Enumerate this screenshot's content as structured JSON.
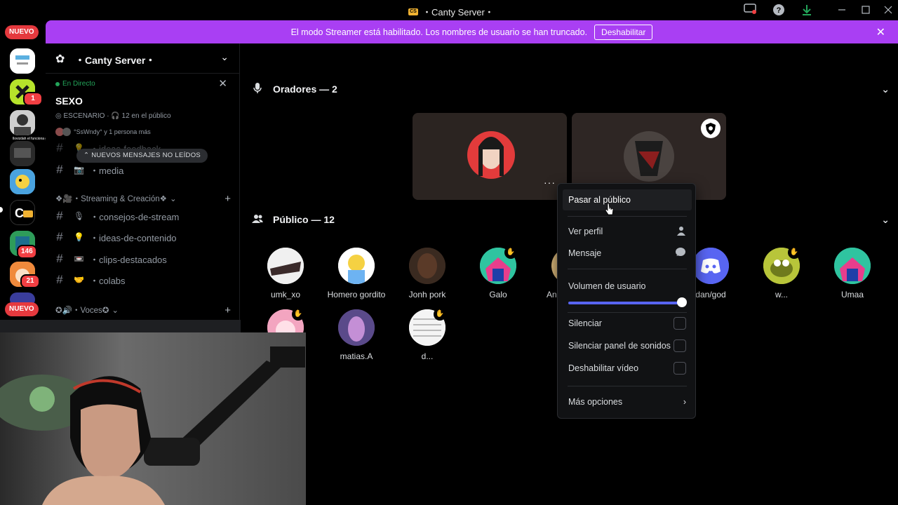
{
  "titlebar": {
    "title": "・Canty Server・",
    "logo_text": "CS"
  },
  "banner": {
    "message": "El modo Streamer está habilitado. Los nombres de usuario se han truncado.",
    "button": "Deshabilitar"
  },
  "rail": {
    "badges": [
      "NUEVO",
      "NUEVO"
    ],
    "counts": [
      "1",
      "146",
      "21"
    ],
    "overlay_text": "llovizdah  el funciona gil"
  },
  "sidebar": {
    "server_name": "・Canty Server・",
    "stage": {
      "live_label": "En Directo",
      "title": "SEXO",
      "meta": "ESCENARIO · 🎧 12 en el público",
      "people": "°SsWndy° y 1 persona más"
    },
    "unread_pill": "NUEVOS MENSAJES NO LEÍDOS",
    "channels_top": [
      {
        "emoji": "💡",
        "name": "・ideas-feedback"
      },
      {
        "emoji": "📷",
        "name": "・media"
      }
    ],
    "category1": "❖🎥・Streaming & Creación❖",
    "channels_mid": [
      {
        "emoji": "🎙",
        "name": "・consejos-de-stream"
      },
      {
        "emoji": "💡",
        "name": "・ideas-de-contenido"
      },
      {
        "emoji": "📼",
        "name": "・clips-destacados"
      },
      {
        "emoji": "🤝",
        "name": "・colabs"
      }
    ],
    "category2": "✪🔊・Voces✪"
  },
  "main": {
    "speakers_header": "Oradores — 2",
    "audience_header": "Público — 12",
    "audience": [
      {
        "name": "umk_xo"
      },
      {
        "name": "Homero gordito"
      },
      {
        "name": "Jonh pork"
      },
      {
        "name": "Galo"
      },
      {
        "name": "An"
      },
      {
        "name": "dan/god"
      },
      {
        "name": "w..."
      },
      {
        "name": "Umaa"
      },
      {
        "name": ""
      },
      {
        "name": "matias.A"
      },
      {
        "name": "d..."
      }
    ]
  },
  "menu": {
    "move_to_audience": "Pasar al público",
    "view_profile": "Ver perfil",
    "message": "Mensaje",
    "user_volume": "Volumen de usuario",
    "volume_level": 1.0,
    "mute": "Silenciar",
    "mute_soundboard": "Silenciar panel de sonidos",
    "disable_video": "Deshabilitar vídeo",
    "more_options": "Más opciones"
  },
  "colors": {
    "banner": "#a93ff3",
    "accent": "#5865f2",
    "live": "#23a55a",
    "badge": "#e5393e"
  }
}
